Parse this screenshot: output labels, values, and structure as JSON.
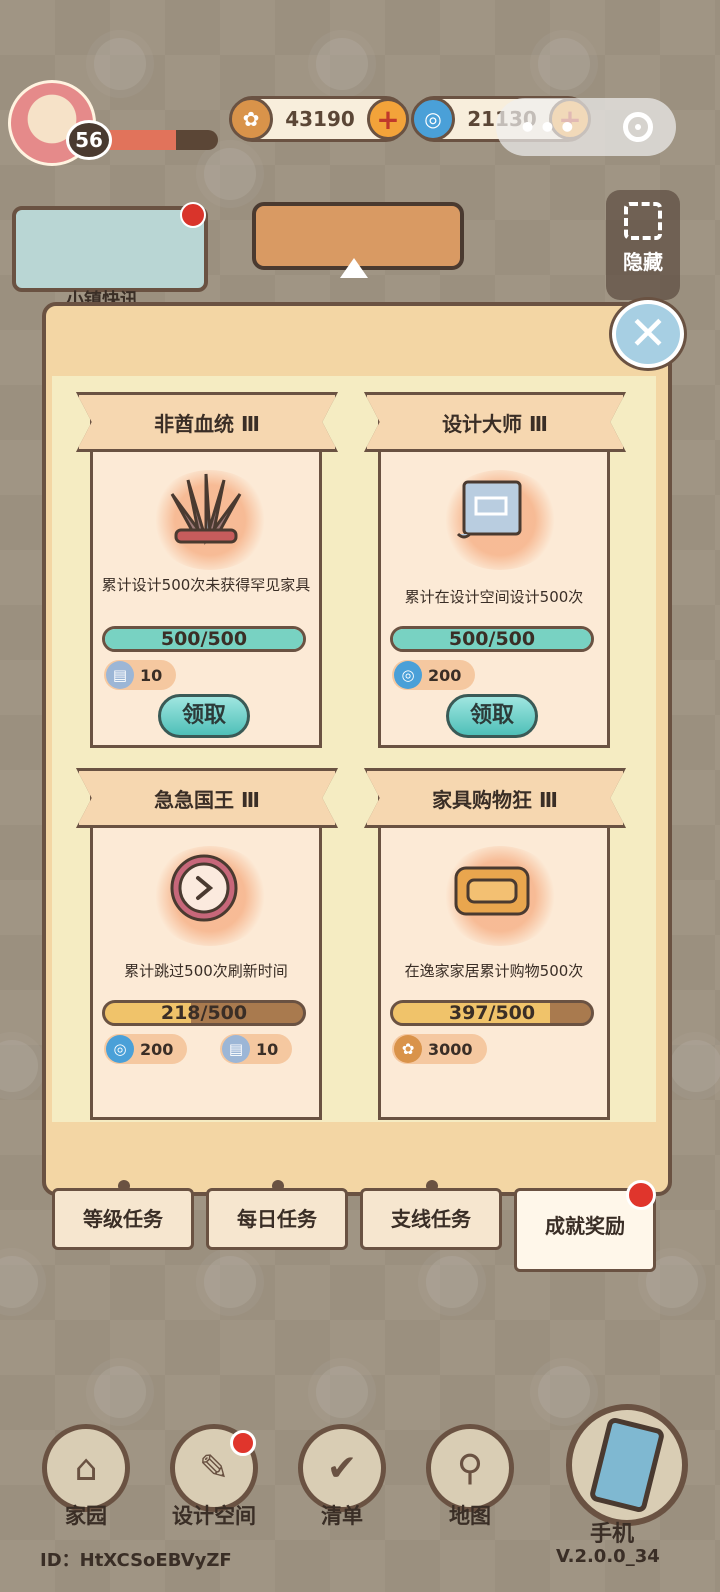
{
  "hud": {
    "level": "56",
    "xp_fraction": 0.64,
    "gold": "43190",
    "gems": "21130",
    "plus": "+",
    "capsule_dots": "•••",
    "news_label": "小镇快讯",
    "hide_label": "隐藏"
  },
  "panel": {
    "close_label": "✕",
    "cards": [
      {
        "title": "非酋血统 Ⅲ",
        "icon": "feather-headdress-icon",
        "desc": "累计设计500次未获得罕见家具",
        "progress_text": "500/500",
        "progress_fraction": 1.0,
        "progress_color": "#78d2c2",
        "rewards": [
          {
            "icon": "ticket-icon",
            "value": "10",
            "color": "#9cb6d6"
          }
        ],
        "claim_label": "领取"
      },
      {
        "title": "设计大师 Ⅲ",
        "icon": "blueprint-icon",
        "desc": "累计在设计空间设计500次",
        "progress_text": "500/500",
        "progress_fraction": 1.0,
        "progress_color": "#78d2c2",
        "rewards": [
          {
            "icon": "gem-icon",
            "value": "200",
            "color": "#4aa0d8"
          }
        ],
        "claim_label": "领取"
      },
      {
        "title": "急急国王 Ⅲ",
        "icon": "clock-icon",
        "desc": "累计跳过500次刷新时间",
        "progress_text": "218/500",
        "progress_fraction": 0.436,
        "progress_color": "#f0c36a",
        "rewards": [
          {
            "icon": "gem-icon",
            "value": "200",
            "color": "#4aa0d8"
          },
          {
            "icon": "ticket-icon",
            "value": "10",
            "color": "#9cb6d6"
          }
        ]
      },
      {
        "title": "家具购物狂 Ⅲ",
        "icon": "sofa-icon",
        "desc": "在逸家家居累计购物500次",
        "progress_text": "397/500",
        "progress_fraction": 0.794,
        "progress_color": "#f0c36a",
        "rewards": [
          {
            "icon": "gold-coin-icon",
            "value": "3000",
            "color": "#d9934a"
          }
        ]
      }
    ],
    "tabs": [
      "等级任务",
      "每日任务",
      "支线任务",
      "成就奖励"
    ],
    "active_tab": "成就奖励"
  },
  "nav": {
    "items": [
      "家园",
      "设计空间",
      "清单",
      "地图"
    ],
    "phone_label": "手机",
    "user_id": "ID：HtXCSoEBVyZF",
    "version": "V.2.0.0_34"
  },
  "colors": {
    "frame_brown": "#6a5242",
    "panel_bg": "#f3d6a4",
    "claim_teal": "#4fc0b8",
    "badge_red": "#e0352c"
  }
}
